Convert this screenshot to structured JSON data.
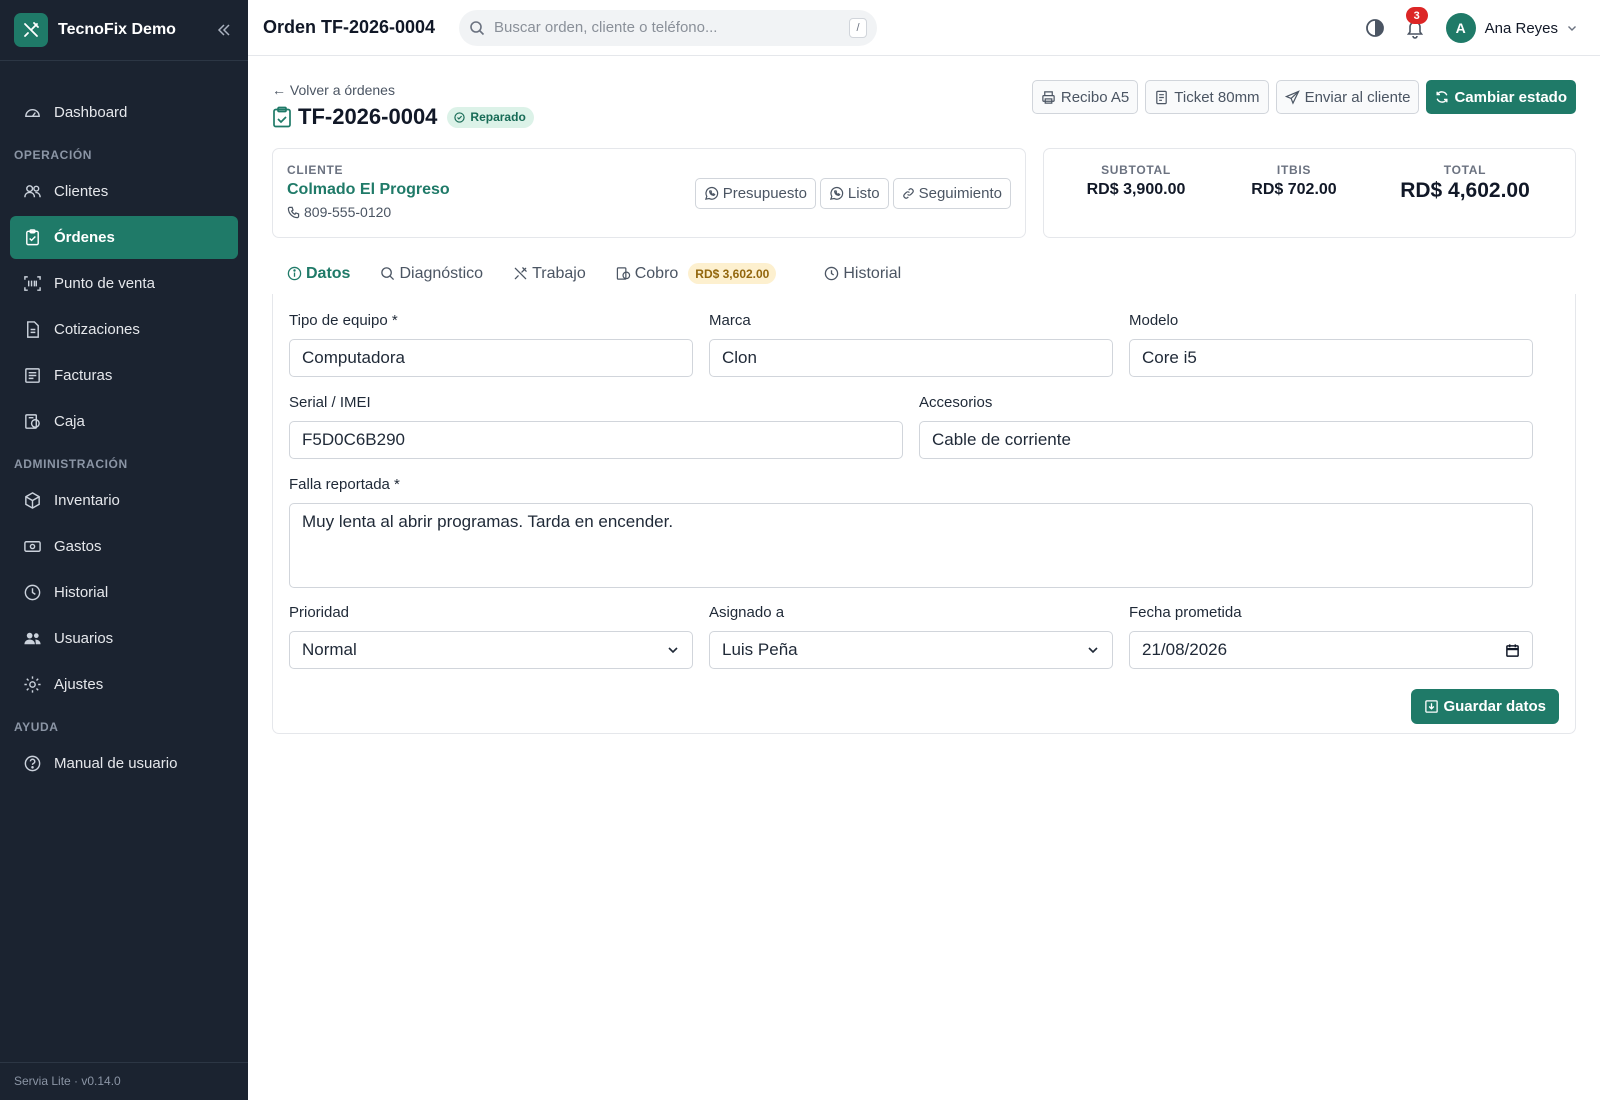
{
  "app": {
    "name": "TecnoFix Demo",
    "version": "Servia Lite · v0.14.0"
  },
  "sidebar": {
    "items": [
      {
        "label": "Dashboard"
      },
      {
        "label": "Clientes"
      },
      {
        "label": "Órdenes"
      },
      {
        "label": "Punto de venta"
      },
      {
        "label": "Cotizaciones"
      },
      {
        "label": "Facturas"
      },
      {
        "label": "Caja"
      },
      {
        "label": "Inventario"
      },
      {
        "label": "Gastos"
      },
      {
        "label": "Historial"
      },
      {
        "label": "Usuarios"
      },
      {
        "label": "Ajustes"
      },
      {
        "label": "Manual de usuario"
      }
    ],
    "sections": [
      "OPERACIÓN",
      "ADMINISTRACIÓN",
      "AYUDA"
    ],
    "active": "Órdenes"
  },
  "topbar": {
    "title": "Orden TF-2026-0004",
    "search_placeholder": "Buscar orden, cliente o teléfono...",
    "search_shortcut": "/",
    "notifications": "3",
    "user_initial": "A",
    "user_name": "Ana Reyes"
  },
  "order": {
    "back": "← Volver a órdenes",
    "code": "TF-2026-0004",
    "status": "Reparado",
    "actions": {
      "receipt": "Recibo A5",
      "ticket": "Ticket 80mm",
      "send": "Enviar al cliente",
      "change_status": "Cambiar estado"
    }
  },
  "client": {
    "label": "CLIENTE",
    "name": "Colmado El Progreso",
    "phone": "809-555-0120",
    "actions": {
      "quote": "Presupuesto",
      "ready": "Listo",
      "tracking": "Seguimiento"
    }
  },
  "totals": {
    "subtotal_label": "SUBTOTAL",
    "subtotal": "RD$ 3,900.00",
    "itbis_label": "ITBIS",
    "itbis": "RD$ 702.00",
    "total_label": "TOTAL",
    "total": "RD$ 4,602.00"
  },
  "tabs": [
    {
      "label": "Datos"
    },
    {
      "label": "Diagnóstico"
    },
    {
      "label": "Trabajo"
    },
    {
      "label": "Cobro",
      "badge": "RD$ 3,602.00"
    },
    {
      "label": "Historial"
    }
  ],
  "form": {
    "device_type": {
      "label": "Tipo de equipo *",
      "value": "Computadora"
    },
    "brand": {
      "label": "Marca",
      "value": "Clon"
    },
    "model": {
      "label": "Modelo",
      "value": "Core i5"
    },
    "serial": {
      "label": "Serial / IMEI",
      "value": "F5D0C6B290"
    },
    "accessories": {
      "label": "Accesorios",
      "value": "Cable de corriente"
    },
    "issue": {
      "label": "Falla reportada *",
      "value": "Muy lenta al abrir programas. Tarda en encender."
    },
    "priority": {
      "label": "Prioridad",
      "value": "Normal"
    },
    "assigned": {
      "label": "Asignado a",
      "value": "Luis Peña"
    },
    "due_date": {
      "label": "Fecha prometida",
      "value": "21/08/2026"
    },
    "save": "Guardar datos"
  },
  "colors": {
    "accent": "#1f7a68",
    "sidebar_bg": "#1b2330",
    "badge_red": "#dc2626"
  }
}
